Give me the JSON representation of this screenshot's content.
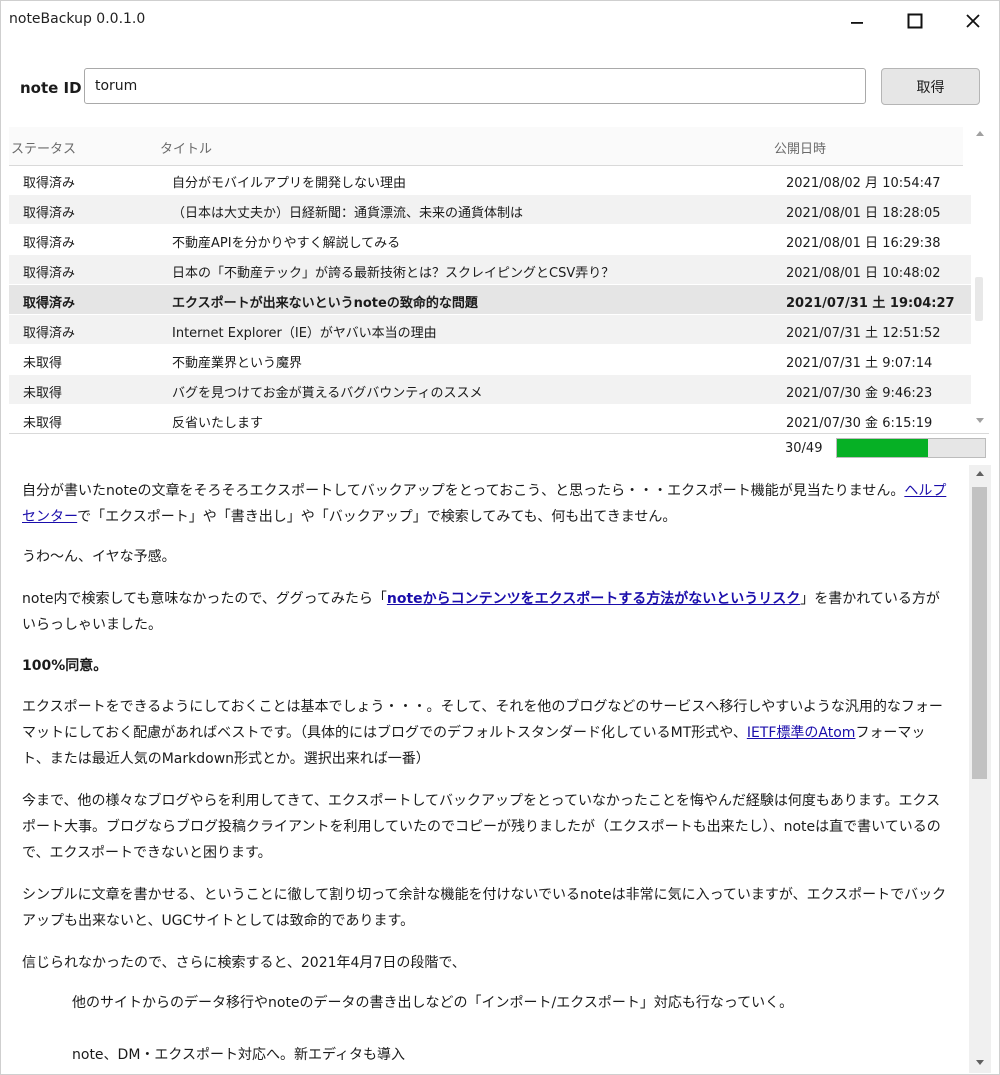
{
  "window": {
    "title": "noteBackup 0.0.1.0"
  },
  "form": {
    "id_label": "note ID",
    "id_value": "torum",
    "fetch_label": "取得"
  },
  "list": {
    "headers": {
      "status": "ステータス",
      "title": "タイトル",
      "date": "公開日時"
    },
    "rows": [
      {
        "status": "取得済み",
        "title": "自分がモバイルアプリを開発しない理由",
        "date": "2021/08/02 月 10:54:47"
      },
      {
        "status": "取得済み",
        "title": "（日本は大丈夫か）日経新聞：通貨漂流、未来の通貨体制は",
        "date": "2021/08/01 日 18:28:05"
      },
      {
        "status": "取得済み",
        "title": "不動産APIを分かりやすく解説してみる",
        "date": "2021/08/01 日 16:29:38"
      },
      {
        "status": "取得済み",
        "title": "日本の「不動産テック」が誇る最新技術とは？スクレイピングとCSV弄り？",
        "date": "2021/08/01 日 10:48:02"
      },
      {
        "status": "取得済み",
        "title": "エクスポートが出来ないというnoteの致命的な問題",
        "date": "2021/07/31 土 19:04:27"
      },
      {
        "status": "取得済み",
        "title": "Internet Explorer（IE）がヤバい本当の理由",
        "date": "2021/07/31 土 12:51:52"
      },
      {
        "status": "未取得",
        "title": "不動産業界という魔界",
        "date": "2021/07/31 土 9:07:14"
      },
      {
        "status": "未取得",
        "title": "バグを見つけてお金が貰えるバグバウンティのススメ",
        "date": "2021/07/30 金 9:46:23"
      },
      {
        "status": "未取得",
        "title": "反省いたします",
        "date": "2021/07/30 金 6:15:19"
      }
    ]
  },
  "progress": {
    "count_text": "30/49",
    "value": 0.612,
    "color": "#06b025"
  },
  "article": {
    "p1_a": "自分が書いたnoteの文章をそろそろエクスポートしてバックアップをとっておこう、と思ったら・・・エクスポート機能が見当たりません。",
    "p1_link": "ヘルプセンター",
    "p1_b": "で「エクスポート」や「書き出し」や「バックアップ」で検索してみても、何も出てきません。",
    "p2": "うわ〜ん、イヤな予感。",
    "p3_a": "note内で検索しても意味なかったので、ググってみたら「",
    "p3_link": "noteからコンテンツをエクスポートする方法がないというリスク",
    "p3_b": "」を書かれている方がいらっしゃいました。",
    "p4": "100%同意。",
    "p5_a": "エクスポートをできるようにしておくことは基本でしょう・・・。そして、それを他のブログなどのサービスへ移行しやすいような汎用的なフォーマットにしておく配慮があればベストです。（具体的にはブログでのデフォルトスタンダード化しているMT形式や、",
    "p5_link": "IETF標準のAtom",
    "p5_b": "フォーマット、または最近人気のMarkdown形式とか。選択出来れば一番）",
    "p6": "今まで、他の様々なブログやらを利用してきて、エクスポートしてバックアップをとっていなかったことを悔やんだ経験は何度もあります。エクスポート大事。ブログならブログ投稿クライアントを利用していたのでコピーが残りましたが（エクスポートも出来たし）、noteは直で書いているので、エクスポートできないと困ります。",
    "p7": "シンプルに文章を書かせる、ということに徹して割り切って余計な機能を付けないでいるnoteは非常に気に入っていますが、エクスポートでバックアップも出来ないと、UGCサイトとしては致命的であります。",
    "p8": "信じられなかったので、さらに検索すると、2021年4月7日の段階で、",
    "q1": "他のサイトからのデータ移行やnoteのデータの書き出しなどの「インポート/エクスポート」対応も行なっていく。",
    "q2": "note、DM・エクスポート対応へ。新エディタも導入"
  }
}
